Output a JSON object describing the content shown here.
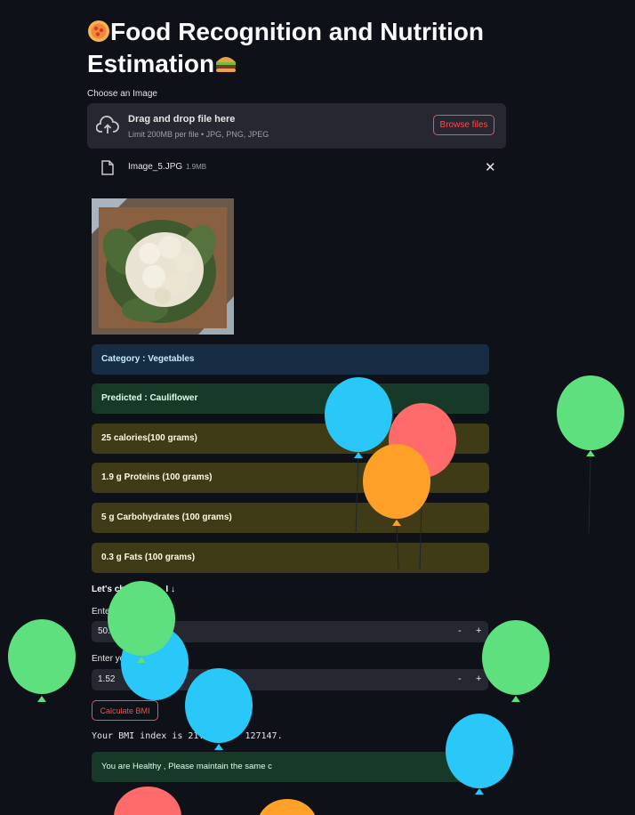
{
  "header": {
    "title_line1": "Food Recognition and Nutrition",
    "title_line2": "Estimation"
  },
  "uploader": {
    "label": "Choose an Image",
    "drag_text": "Drag and drop file here",
    "limit_text": "Limit 200MB per file • JPG, PNG, JPEG",
    "browse_label": "Browse files",
    "file": {
      "name": "Image_5.JPG",
      "size": "1.9MB"
    }
  },
  "results": {
    "category": "Category : Vegetables",
    "predicted": "Predicted : Cauliflower",
    "calories": "25 calories(100 grams)",
    "proteins": "1.9 g Proteins (100 grams)",
    "carbs": "5 g Carbohydrates (100 grams)",
    "fats": "0.3 g Fats (100 grams)"
  },
  "bmi": {
    "heading_visible": "Let's ch",
    "heading_tail": "I ↓",
    "weight_label_visible": "Ente",
    "weight_value_visible": "50.",
    "height_label_visible": "Enter yo",
    "height_value": "1.52",
    "minus": "-",
    "plus": "+",
    "button_label": "Calculate BMI",
    "result_text": "Your BMI index is 21.6",
    "result_tail": "127147.",
    "status": "You are Healthy , Please maintain the same c"
  },
  "colors": {
    "background": "#0e1117",
    "accent": "#ff4b4b",
    "balloon_blue": "#29c8f8",
    "balloon_green": "#5ee07f",
    "balloon_red": "#ff6b6b",
    "balloon_orange": "#ffa028"
  },
  "icons": [
    "pizza-emoji-icon",
    "burger-emoji-icon",
    "upload-cloud-icon",
    "file-icon",
    "close-icon"
  ]
}
